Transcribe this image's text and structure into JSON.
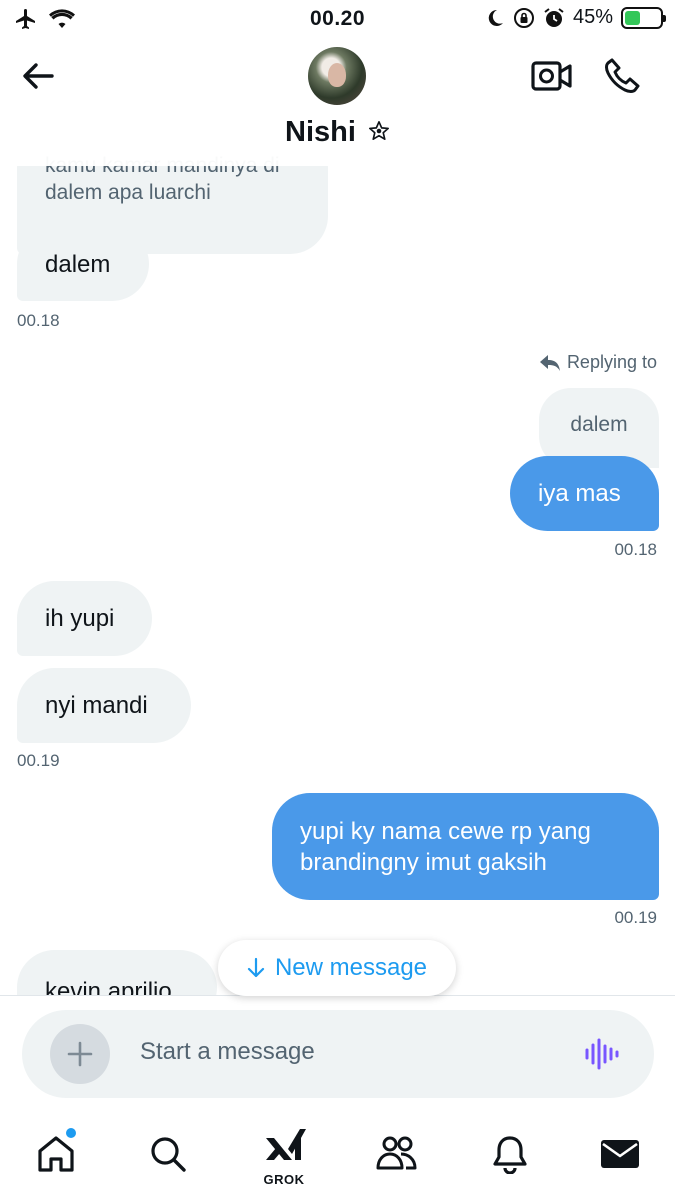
{
  "status_bar": {
    "time": "00.20",
    "battery": "45%",
    "battery_fraction": 0.45
  },
  "header": {
    "contact_name": "Nishi"
  },
  "messages": {
    "m1_text": "kamu kamar mandinya di dalem apa luarchi",
    "m2_text": "dalem",
    "t1": "00.18",
    "reply_label": "Replying to",
    "quoted_text": "dalem",
    "m3_text": "iya mas",
    "t2": "00.18",
    "m4_text": "ih yupi",
    "m5_text": "nyi mandi",
    "t3": "00.19",
    "m6_text": "yupi ky nama cewe rp yang brandingny imut gaksih",
    "t4": "00.19",
    "m7_text": "kevin aprilio"
  },
  "new_message_label": "New message",
  "composer": {
    "placeholder": "Start a message"
  },
  "tabbar": {
    "grok_label": "GROK"
  },
  "colors": {
    "accent": "#1d9bf0",
    "outgoing_bubble": "#4a99e9",
    "incoming_bubble": "#eff3f4",
    "battery": "#34c759"
  },
  "icons": [
    "airplane-icon",
    "wifi-icon",
    "moon-icon",
    "orientation-lock-icon",
    "alarm-icon",
    "battery-icon",
    "back-arrow-icon",
    "verified-star-icon",
    "video-call-icon",
    "phone-icon",
    "reply-icon",
    "arrow-down-icon",
    "plus-icon",
    "voice-icon",
    "home-icon",
    "search-icon",
    "grok-icon",
    "communities-icon",
    "bell-icon",
    "mail-icon"
  ]
}
